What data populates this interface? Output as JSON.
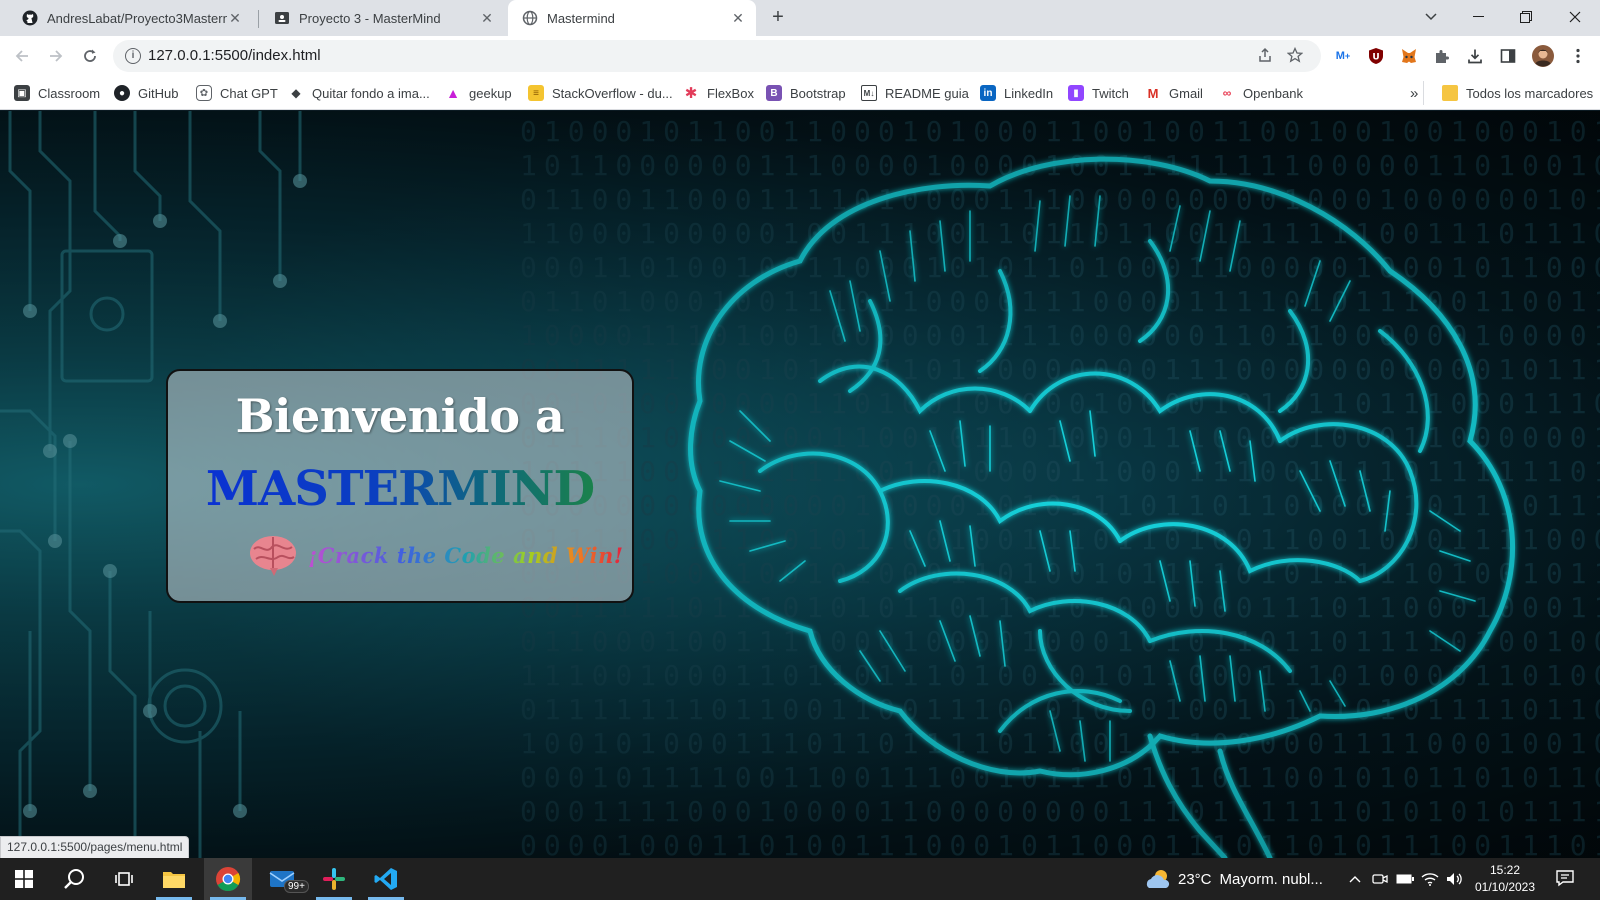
{
  "tabs": [
    {
      "title": "AndresLabat/Proyecto3Mastermind",
      "icon": "github-icon",
      "close": "✕"
    },
    {
      "title": "Proyecto 3 - MasterMind",
      "icon": "classroom-icon",
      "close": "✕"
    },
    {
      "title": "Mastermind",
      "icon": "globe-icon",
      "close": "✕"
    }
  ],
  "new_tab_label": "+",
  "address_bar": {
    "url": "127.0.0.1:5500/index.html"
  },
  "bookmarks": [
    {
      "label": "Classroom",
      "icon": "classroom-icon"
    },
    {
      "label": "GitHub",
      "icon": "github-icon"
    },
    {
      "label": "Chat GPT",
      "icon": "chatgpt-icon"
    },
    {
      "label": "Quitar fondo a ima...",
      "icon": "layers-icon"
    },
    {
      "label": "geekup",
      "icon": "geekup-icon"
    },
    {
      "label": "StackOverflow - du...",
      "icon": "stackoverflow-icon"
    },
    {
      "label": "FlexBox",
      "icon": "flexbox-icon"
    },
    {
      "label": "Bootstrap",
      "icon": "bootstrap-icon"
    },
    {
      "label": "README guia",
      "icon": "markdown-icon"
    },
    {
      "label": "LinkedIn",
      "icon": "linkedin-icon"
    },
    {
      "label": "Twitch",
      "icon": "twitch-icon"
    },
    {
      "label": "Gmail",
      "icon": "gmail-icon"
    },
    {
      "label": "Openbank",
      "icon": "openbank-icon"
    }
  ],
  "bookmarks_overflow": "»",
  "all_bookmarks": "Todos los marcadores",
  "page": {
    "welcome": "Bienvenido a",
    "title": "MASTERMIND",
    "tagline": "¡Crack the Code and Win!"
  },
  "status_link": "127.0.0.1:5500/pages/menu.html",
  "taskbar": {
    "mail_badge": "99+",
    "weather_temp": "23°C",
    "weather_desc": "Mayorm. nubl...",
    "time": "15:22",
    "date": "01/10/2023"
  },
  "colors": {
    "title_gradient_start": "#0a2fd6",
    "title_gradient_end": "#1f8a3a",
    "brain_glow": "#19d6e0",
    "page_background": "#04161d"
  }
}
